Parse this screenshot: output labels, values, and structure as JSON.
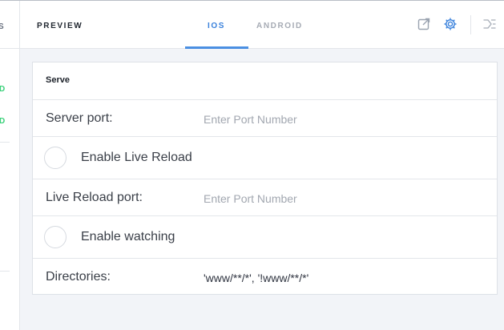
{
  "sidebar": {
    "header_text": "S",
    "status_items": [
      "D",
      "D"
    ],
    "status_color": "#3bd17a"
  },
  "header": {
    "title": "PREVIEW",
    "tabs": [
      {
        "label": "IOS",
        "active": true
      },
      {
        "label": "ANDROID",
        "active": false
      }
    ],
    "accent_color": "#3b82dc",
    "icons": [
      "open-external-icon",
      "gear-icon",
      "collapse-panel-icon"
    ]
  },
  "serve": {
    "section_title": "Serve",
    "server_port": {
      "label": "Server port:",
      "value": "",
      "placeholder": "Enter Port Number"
    },
    "live_reload": {
      "label": "Enable Live Reload",
      "checked": false
    },
    "live_reload_port": {
      "label": "Live Reload port:",
      "value": "",
      "placeholder": "Enter Port Number"
    },
    "watching": {
      "label": "Enable watching",
      "checked": false
    },
    "directories": {
      "label": "Directories:",
      "value": "'www/**/*', '!www/**/*'"
    }
  }
}
